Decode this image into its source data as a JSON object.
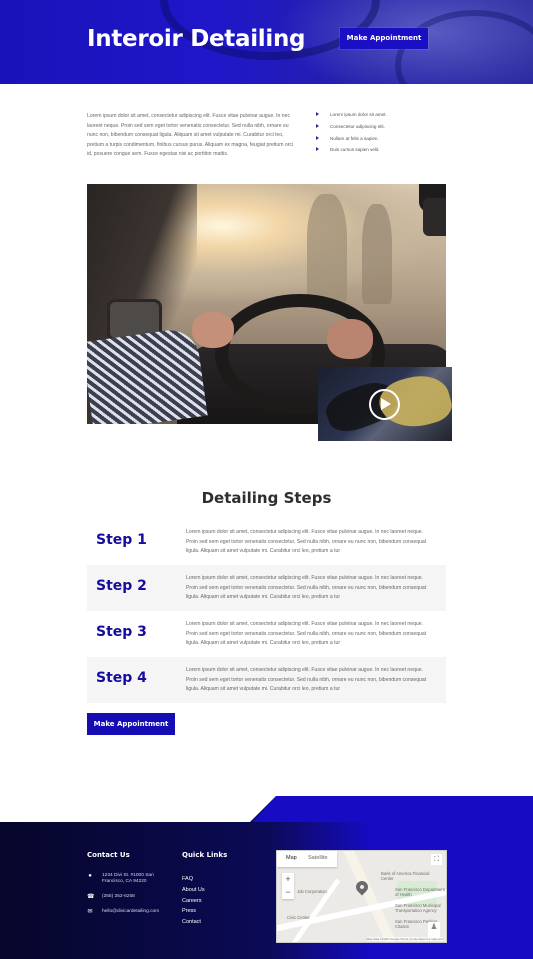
{
  "hero": {
    "title": "Interoir Detailing",
    "cta_label": "Make Appointment"
  },
  "intro": {
    "paragraph": "Lorem ipsum dolor sit amet, consectetur adipiscing elit. Fusce vitae pulvinar augue. In nec laoreet neque. Proin sed sem eget tortor venenatis consectetur. Sed nulla nibh, ornare eu nunc non, bibendum consequat ligula. Aliquam sit amet vulputate mi. Curabitur orci leo, pretium a turpis condimentum, finibus cursus purus. Aliquam ex magna, feugiat pretium orci id, posuere congue sem. Fusce egestas nisi ac porttitor mattis.",
    "bullets": [
      "Lorem ipsum dolor sit amet.",
      "Consectetur adipiscing elit.",
      "Nullam at felis a sapien.",
      "Duis cursus sapien velit."
    ]
  },
  "steps": {
    "title": "Detailing Steps",
    "items": [
      {
        "label": "Step 1",
        "text": "Lorem ipsum dolor sit amet, consectetur adipiscing elit. Fusce vitae pulvinar augue. In nec laoreet neque. Proin sed sem eget tortor venenatis consectetur. Sed nulla nibh, ornare eu nunc non, bibendum consequat ligula. Aliquam sit amet vulputate mi. Curabitur orci leo, pretium a tur"
      },
      {
        "label": "Step 2",
        "text": "Lorem ipsum dolor sit amet, consectetur adipiscing elit. Fusce vitae pulvinar augue. In nec laoreet neque. Proin sed sem eget tortor venenatis consectetur. Sed nulla nibh, ornare eu nunc non, bibendum consequat ligula. Aliquam sit amet vulputate mi. Curabitur orci leo, pretium a tur"
      },
      {
        "label": "Step 3",
        "text": "Lorem ipsum dolor sit amet, consectetur adipiscing elit. Fusce vitae pulvinar augue. In nec laoreet neque. Proin sed sem eget tortor venenatis consectetur. Sed nulla nibh, ornare eu nunc non, bibendum consequat ligula. Aliquam sit amet vulputate mi. Curabitur orci leo, pretium a tur"
      },
      {
        "label": "Step 4",
        "text": "Lorem ipsum dolor sit amet, consectetur adipiscing elit. Fusce vitae pulvinar augue. In nec laoreet neque. Proin sed sem eget tortor venenatis consectetur. Sed nulla nibh, ornare eu nunc non, bibendum consequat ligula. Aliquam sit amet vulputate mi. Curabitur orci leo, pretium a tur"
      }
    ],
    "cta_label": "Make Appointment"
  },
  "footer": {
    "contact_title": "Contact Us",
    "address": "1234 Divi St. #1000 San Francisco, CA 94220",
    "phone": "(255) 352-6258",
    "email": "hello@divicardetailing.com",
    "links_title": "Quick Links",
    "links": [
      "FAQ",
      "About Us",
      "Careers",
      "Press",
      "Contact"
    ]
  },
  "map": {
    "tab_map": "Map",
    "tab_satellite": "Satellite",
    "zoom_in": "+",
    "zoom_out": "−",
    "labels": [
      "Bank of America Financial Center",
      "San Francisco Department of Health",
      "San Francisco Municipal Transportation Agency",
      "San Francisco Parking Citation",
      "Job Corporation",
      "Civic Center"
    ],
    "attribution": "Map data ©2020 Google   Terms of Use   Report a map error"
  },
  "colors": {
    "brand_blue": "#150cb3",
    "step_label": "#160c9e",
    "footer_dark": "#06062a"
  },
  "icons": [
    "location-icon",
    "phone-icon",
    "email-icon",
    "play-icon",
    "fullscreen-icon",
    "pegman-icon"
  ]
}
